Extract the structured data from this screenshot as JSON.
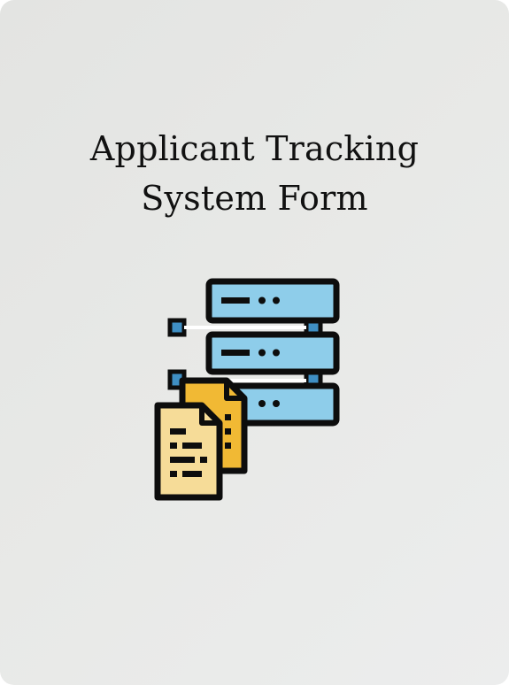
{
  "card": {
    "title_line1": "Applicant Tracking",
    "title_line2": "System Form",
    "icon": "server-with-documents-icon"
  },
  "colors": {
    "background": "#e6e7e5",
    "server_fill": "#8ecdea",
    "server_connector": "#3f8fc4",
    "document_back": "#f1b934",
    "document_front": "#f6dc98",
    "outline": "#0d0d0d"
  }
}
